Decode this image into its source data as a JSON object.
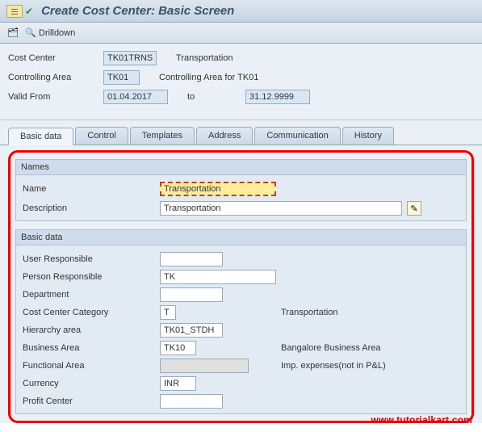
{
  "title": "Create Cost Center: Basic Screen",
  "toolbar": {
    "drilldown": "Drilldown"
  },
  "header": {
    "cost_center_label": "Cost Center",
    "cost_center_value": "TK01TRNS",
    "cost_center_desc": "Transportation",
    "controlling_area_label": "Controlling Area",
    "controlling_area_value": "TK01",
    "controlling_area_desc": "Controlling Area for TK01",
    "valid_from_label": "Valid From",
    "valid_from_value": "01.04.2017",
    "to_label": "to",
    "valid_to_value": "31.12.9999"
  },
  "tabs": [
    "Basic data",
    "Control",
    "Templates",
    "Address",
    "Communication",
    "History"
  ],
  "names_group": {
    "header": "Names",
    "name_label": "Name",
    "name_value": "Transportation",
    "desc_label": "Description",
    "desc_value": "Transportation"
  },
  "basic_group": {
    "header": "Basic data",
    "user_resp_label": "User Responsible",
    "user_resp_value": "",
    "person_resp_label": "Person Responsible",
    "person_resp_value": "TK",
    "department_label": "Department",
    "department_value": "",
    "category_label": "Cost Center Category",
    "category_value": "T",
    "category_desc": "Transportation",
    "hierarchy_label": "Hierarchy area",
    "hierarchy_value": "TK01_STDH",
    "business_area_label": "Business Area",
    "business_area_value": "TK10",
    "business_area_desc": "Bangalore Business Area",
    "functional_area_label": "Functional Area",
    "functional_area_value": "",
    "functional_area_desc": "Imp. expenses(not in P&L)",
    "currency_label": "Currency",
    "currency_value": "INR",
    "profit_center_label": "Profit Center",
    "profit_center_value": ""
  },
  "watermark": "www.tutorialkart.com"
}
